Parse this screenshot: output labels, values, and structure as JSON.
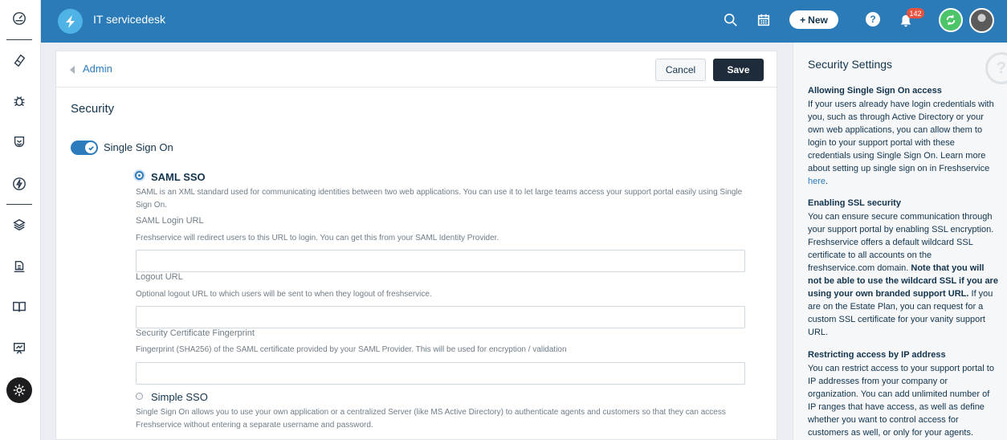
{
  "header": {
    "app_title": "IT servicedesk",
    "new_button_label": "New",
    "notification_count": "142",
    "help_label": "?"
  },
  "sidebar": {
    "items": [
      "dashboard-icon",
      "tickets-icon",
      "problems-icon",
      "changes-icon",
      "releases-icon",
      "assets-icon",
      "contracts-icon",
      "solutions-icon",
      "reports-icon",
      "admin-icon"
    ]
  },
  "page": {
    "breadcrumb": "Admin",
    "cancel_label": "Cancel",
    "save_label": "Save",
    "section_title": "Security",
    "sso_toggle": {
      "label": "Single Sign On",
      "enabled": true
    },
    "saml": {
      "title": "SAML SSO",
      "selected": true,
      "description": "SAML is an XML standard used for communicating identities between two web applications. You can use it to let large teams access your support portal easily using Single Sign On.",
      "login_url_label": "SAML Login URL",
      "login_url_help": "Freshservice will redirect users to this URL to login. You can get this from your SAML Identity Provider.",
      "login_url_value": "",
      "logout_url_label": "Logout URL",
      "logout_url_help": "Optional logout URL to which users will be sent to when they logout of freshservice.",
      "logout_url_value": "",
      "fingerprint_label": "Security Certificate Fingerprint",
      "fingerprint_help": "Fingerprint (SHA256) of the SAML certificate provided by your SAML Provider. This will be used for encryption / validation",
      "fingerprint_value": ""
    },
    "simple": {
      "title": "Simple SSO",
      "selected": false,
      "description": "Single Sign On allows you to use your own application or a centralized Server (like MS Active Directory) to authenticate agents and customers so that they can access Freshservice without entering a separate username and password."
    }
  },
  "help_panel": {
    "heading": "Security Settings",
    "sections": [
      {
        "title": "Allowing Single Sign On access",
        "text": "If your users already have login credentials with you, such as through Active Directory or your own web applications, you can allow them to login to your support portal with these credentials using Single Sign On. Learn more about setting up single sign on in Freshservice ",
        "link": "here",
        "after": "."
      },
      {
        "title": "Enabling SSL security",
        "text": "You can ensure secure communication through your support portal by enabling SSL encryption. Freshservice offers a default wildcard SSL certificate to all accounts on the freshservice.com domain. ",
        "bold": "Note that you will not be able to use the wildcard SSL if you are using your own branded support URL.",
        "after": " If you are on the Estate Plan, you can request for a custom SSL certificate for your vanity support URL."
      },
      {
        "title": "Restricting access by IP address",
        "text": "You can restrict access to your support portal to IP addresses from your company or organization. You can add unlimited number of IP ranges that have access, as well as define whether you want to control access for customers as well, or only for your agents."
      }
    ]
  },
  "colors": {
    "header_bg": "#2a7bb8",
    "accent": "#2c7cbd",
    "save_bg": "#1e2b3a",
    "notification": "#e5533f",
    "status_green": "#4cc56a"
  }
}
